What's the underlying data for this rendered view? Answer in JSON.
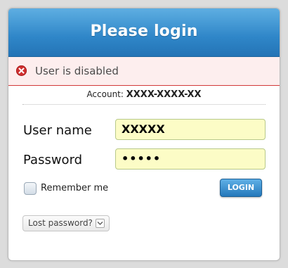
{
  "header": {
    "title": "Please login"
  },
  "error": {
    "message": "User is disabled",
    "icon": "error-icon"
  },
  "account": {
    "label": "Account:",
    "value": "XXXX-XXXX-XX"
  },
  "form": {
    "username_label": "User name",
    "username_value": "XXXXX",
    "password_label": "Password",
    "password_value": "•••••",
    "remember_label": "Remember me",
    "login_label": "LOGIN",
    "lost_password_label": "Lost password?"
  },
  "colors": {
    "header_blue": "#2f86c8",
    "error_red": "#d03030",
    "input_yellow": "#fcfcc6"
  }
}
